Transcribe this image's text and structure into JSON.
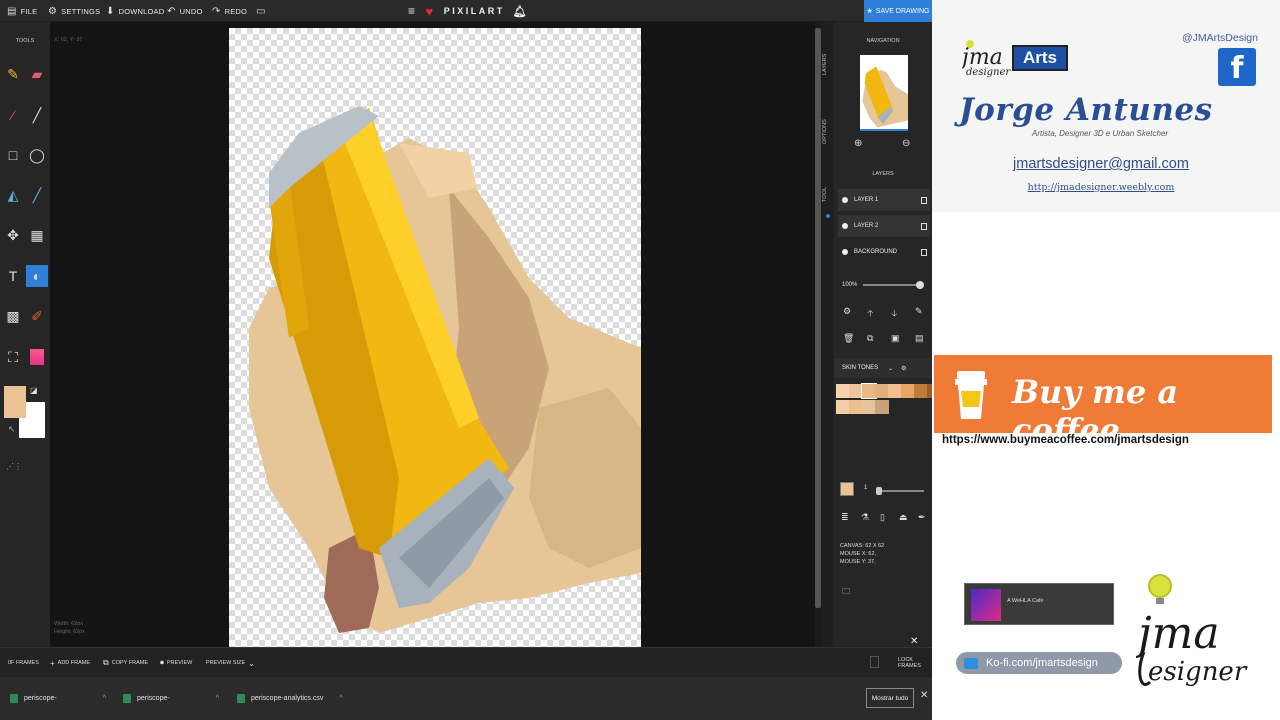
{
  "app": {
    "brand": "PIXILART"
  },
  "menu": {
    "file": "FILE",
    "settings": "SETTINGS",
    "download": "DOWNLOAD",
    "undo": "UNDO",
    "redo": "REDO",
    "save": "SAVE DRAWING"
  },
  "tools": {
    "title": "TOOLS",
    "icons": [
      "pencil-icon",
      "eraser-icon",
      "brush-icon",
      "line-icon",
      "rectangle-icon",
      "ellipse-icon",
      "bucket-icon",
      "dropper-icon",
      "move-icon",
      "selection-icon",
      "text-icon",
      "lighten-icon",
      "dither-icon",
      "color-pick-icon",
      "crop-icon",
      "gradient-icon"
    ],
    "active": "lighten-icon",
    "primary_color": "#e9c393",
    "secondary_color": "#ffffff"
  },
  "readouts": {
    "cursor": "X: 62, Y: 37",
    "size_width": "Width: 62px",
    "size_height": "Height: 62px"
  },
  "side_tabs": {
    "layers": "LAYERS",
    "options": "OPTIONS",
    "tool": "TOOL"
  },
  "navigation": {
    "title": "NAVIGATION"
  },
  "layers": {
    "title": "LAYERS",
    "items": [
      {
        "name": "LAYER 1",
        "selected": true
      },
      {
        "name": "LAYER 2",
        "selected": true
      },
      {
        "name": "BACKGROUND",
        "selected": false
      }
    ],
    "opacity": "100%"
  },
  "palette": {
    "name": "SKIN TONES",
    "colors": [
      "#f6d2ad",
      "#efc49a",
      "#e8b886",
      "#e2b07a",
      "#f2c08e",
      "#e6a868",
      "#c07c3c",
      "#a05a2c",
      "#f4cfa6",
      "#ecbf8e",
      "#e7c39a",
      "#c9a27a"
    ]
  },
  "brush": {
    "size": "1"
  },
  "canvas_info": {
    "canvas": "CANVAS: 62 X 62",
    "mouse_x": "MOUSE X: 62,",
    "mouse_y": "MOUSE Y: 37,"
  },
  "framebar": {
    "frames": "0F FRAMES",
    "add_frame": "ADD FRAME",
    "copy_frame": "COPY FRAME",
    "preview": "PREVIEW",
    "preview_size": "PREVIEW SIZE",
    "lock_frames": "LOCK FRAMES"
  },
  "taskbar": {
    "items": [
      "periscope-",
      "periscope-",
      "periscope-analytics.csv"
    ],
    "show_all": "Mostrar tudo"
  },
  "promo": {
    "arts": "Arts",
    "handle": "@JMArtsDesign",
    "name": "Jorge Antunes",
    "tagline": "Artista, Designer 3D e Urban Sketcher",
    "email": "jmartsdesigner@gmail.com",
    "website": "http://jmadesigner.weebly.com",
    "coffee": "Buy me a coffee",
    "coffee_url": "https://www.buymeacoffee.com/jmartsdesign",
    "cafe_label": "A WeHLA Cafe",
    "kofi": "Ko-fi.com/jmartsdesign"
  }
}
